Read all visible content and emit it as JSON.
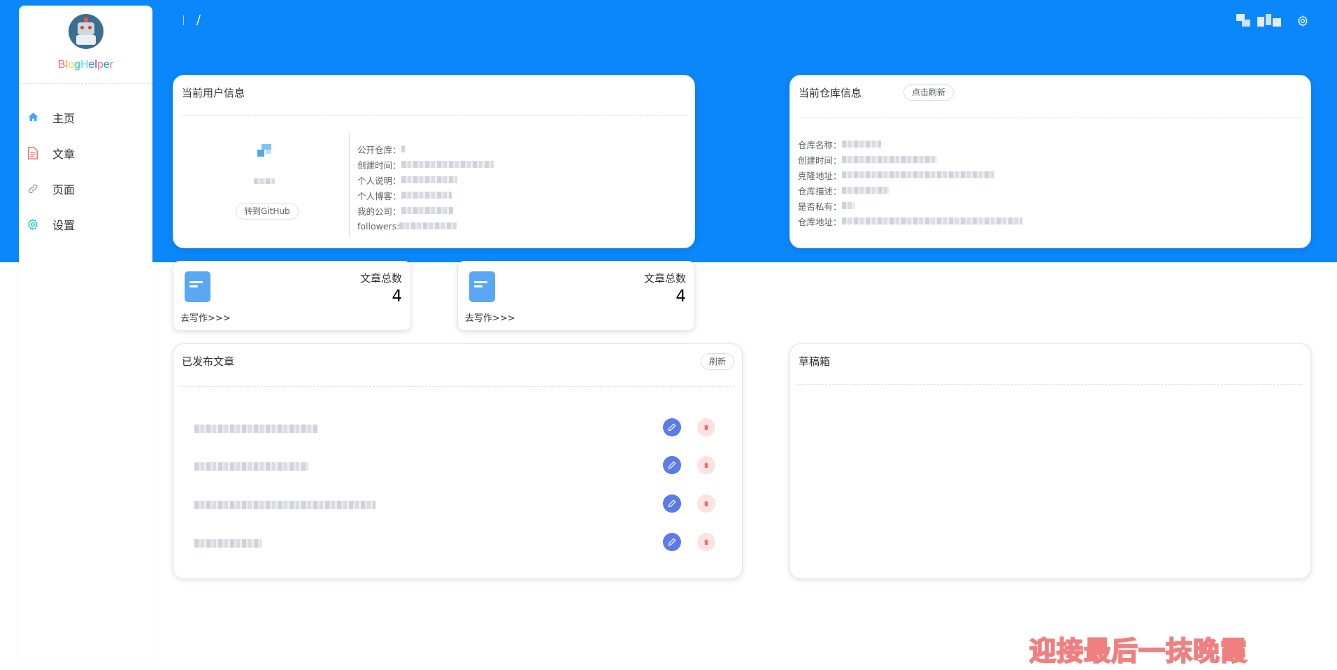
{
  "colors": {
    "band": "#0a87fb",
    "accent": "#5aa8f5",
    "edit": "#5b7be8",
    "delete_bg": "#fde2e2",
    "delete_icon": "#f56c6c"
  },
  "sidebar": {
    "logo_text": "BlogHelper",
    "items": [
      {
        "label": "主页",
        "icon": "home-icon",
        "color": "#3fa9f5"
      },
      {
        "label": "文章",
        "icon": "document-icon",
        "color": "#f56c6c"
      },
      {
        "label": "页面",
        "icon": "link-icon",
        "color": "#909399"
      },
      {
        "label": "设置",
        "icon": "gear-icon",
        "color": "#13c2c2"
      }
    ]
  },
  "header": {
    "breadcrumb_sep": "/",
    "settings_icon": "gear-icon"
  },
  "user_card": {
    "title": "当前用户信息",
    "github_button": "转到GitHub",
    "rows": [
      {
        "label": "公开仓库："
      },
      {
        "label": "创建时间："
      },
      {
        "label": "个人说明："
      },
      {
        "label": "个人博客："
      },
      {
        "label": "我的公司："
      },
      {
        "label": "followers:"
      }
    ]
  },
  "repo_card": {
    "title": "当前仓库信息",
    "refresh_button": "点击刷新",
    "rows": [
      {
        "label": "仓库名称："
      },
      {
        "label": "创建时间："
      },
      {
        "label": "克隆地址："
      },
      {
        "label": "仓库描述："
      },
      {
        "label": "是否私有："
      },
      {
        "label": "仓库地址："
      }
    ]
  },
  "stats": [
    {
      "label": "文章总数",
      "value": "4",
      "link": "去写作>>>",
      "icon": "document-icon"
    },
    {
      "label": "文章总数",
      "value": "4",
      "link": "去写作>>>",
      "icon": "document-icon"
    }
  ],
  "published": {
    "title": "已发布文章",
    "refresh_button": "刷新",
    "articles": [
      {},
      {},
      {},
      {}
    ]
  },
  "drafts": {
    "title": "草稿箱"
  },
  "watermark": "迎接最后一抹晚霞"
}
